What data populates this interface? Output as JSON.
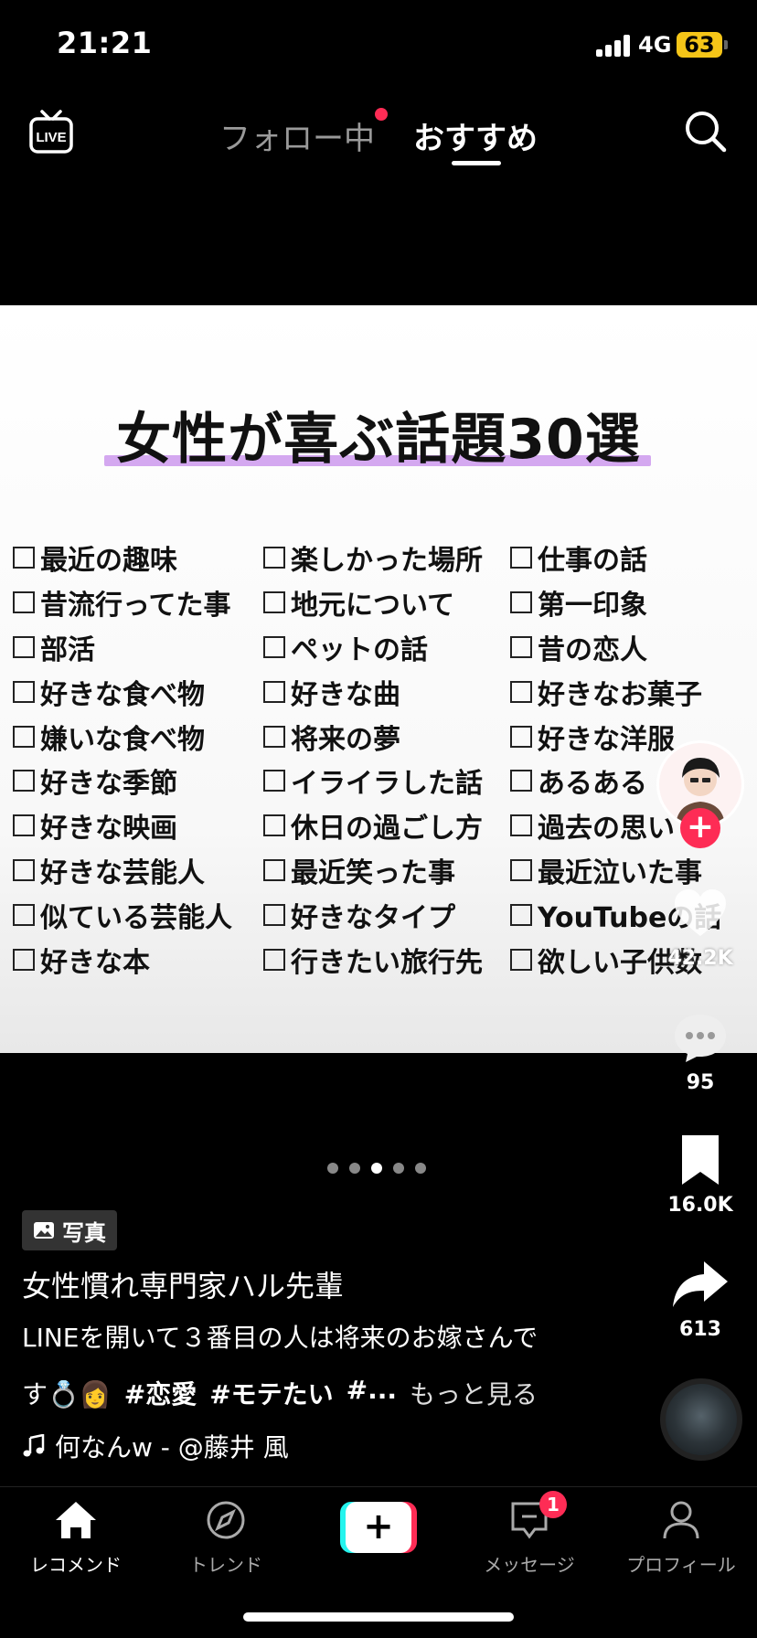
{
  "status_bar": {
    "time": "21:21",
    "network": "4G",
    "battery": "63"
  },
  "top_nav": {
    "live_label": "LIVE",
    "tab_following": "フォロー中",
    "tab_foryou": "おすすめ"
  },
  "post": {
    "title": "女性が喜ぶ話題30選",
    "columns": [
      [
        "最近の趣味",
        "昔流行ってた事",
        "部活",
        "好きな食べ物",
        "嫌いな食べ物",
        "好きな季節",
        "好きな映画",
        "好きな芸能人",
        "似ている芸能人",
        "好きな本"
      ],
      [
        "楽しかった場所",
        "地元について",
        "ペットの話",
        "好きな曲",
        "将来の夢",
        "イライラした話",
        "休日の過ごし方",
        "最近笑った事",
        "好きなタイプ",
        "行きたい旅行先"
      ],
      [
        "仕事の話",
        "第一印象",
        "昔の恋人",
        "好きなお菓子",
        "好きな洋服",
        "あるある",
        "過去の思い",
        "最近泣いた事",
        "YouTubeの話",
        "欲しい子供数"
      ]
    ]
  },
  "actions": {
    "likes": "42.2K",
    "comments": "95",
    "saves": "16.0K",
    "shares": "613"
  },
  "caption": {
    "badge": "写真",
    "author": "女性慣れ専門家ハル先輩",
    "line1": "LINEを開いて３番目の人は将来のお嫁さんで",
    "line2_prefix": "す💍👩",
    "hashtags": [
      "#恋愛",
      "#モテたい",
      "#..."
    ],
    "see_more": "もっと見る",
    "music": "何なんw - @藤井 風"
  },
  "bottom_nav": {
    "home": "レコメンド",
    "discover": "トレンド",
    "create": "+",
    "inbox": "メッセージ",
    "inbox_badge": "1",
    "profile": "プロフィール"
  }
}
